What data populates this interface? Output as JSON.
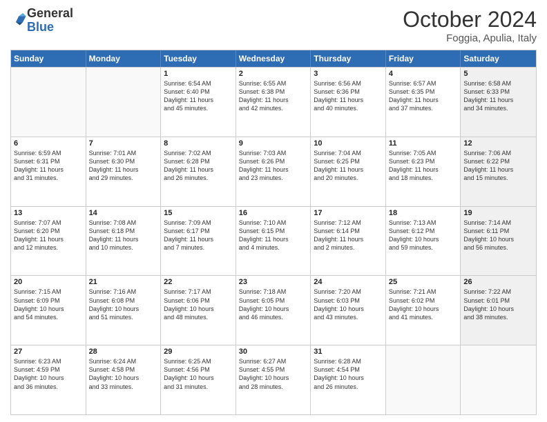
{
  "logo": {
    "general": "General",
    "blue": "Blue"
  },
  "header": {
    "month": "October 2024",
    "location": "Foggia, Apulia, Italy"
  },
  "days_of_week": [
    "Sunday",
    "Monday",
    "Tuesday",
    "Wednesday",
    "Thursday",
    "Friday",
    "Saturday"
  ],
  "weeks": [
    [
      {
        "day": "",
        "lines": [],
        "empty": true
      },
      {
        "day": "",
        "lines": [],
        "empty": true
      },
      {
        "day": "1",
        "lines": [
          "Sunrise: 6:54 AM",
          "Sunset: 6:40 PM",
          "Daylight: 11 hours",
          "and 45 minutes."
        ],
        "empty": false
      },
      {
        "day": "2",
        "lines": [
          "Sunrise: 6:55 AM",
          "Sunset: 6:38 PM",
          "Daylight: 11 hours",
          "and 42 minutes."
        ],
        "empty": false
      },
      {
        "day": "3",
        "lines": [
          "Sunrise: 6:56 AM",
          "Sunset: 6:36 PM",
          "Daylight: 11 hours",
          "and 40 minutes."
        ],
        "empty": false
      },
      {
        "day": "4",
        "lines": [
          "Sunrise: 6:57 AM",
          "Sunset: 6:35 PM",
          "Daylight: 11 hours",
          "and 37 minutes."
        ],
        "empty": false
      },
      {
        "day": "5",
        "lines": [
          "Sunrise: 6:58 AM",
          "Sunset: 6:33 PM",
          "Daylight: 11 hours",
          "and 34 minutes."
        ],
        "empty": false,
        "shaded": true
      }
    ],
    [
      {
        "day": "6",
        "lines": [
          "Sunrise: 6:59 AM",
          "Sunset: 6:31 PM",
          "Daylight: 11 hours",
          "and 31 minutes."
        ],
        "empty": false
      },
      {
        "day": "7",
        "lines": [
          "Sunrise: 7:01 AM",
          "Sunset: 6:30 PM",
          "Daylight: 11 hours",
          "and 29 minutes."
        ],
        "empty": false
      },
      {
        "day": "8",
        "lines": [
          "Sunrise: 7:02 AM",
          "Sunset: 6:28 PM",
          "Daylight: 11 hours",
          "and 26 minutes."
        ],
        "empty": false
      },
      {
        "day": "9",
        "lines": [
          "Sunrise: 7:03 AM",
          "Sunset: 6:26 PM",
          "Daylight: 11 hours",
          "and 23 minutes."
        ],
        "empty": false
      },
      {
        "day": "10",
        "lines": [
          "Sunrise: 7:04 AM",
          "Sunset: 6:25 PM",
          "Daylight: 11 hours",
          "and 20 minutes."
        ],
        "empty": false
      },
      {
        "day": "11",
        "lines": [
          "Sunrise: 7:05 AM",
          "Sunset: 6:23 PM",
          "Daylight: 11 hours",
          "and 18 minutes."
        ],
        "empty": false
      },
      {
        "day": "12",
        "lines": [
          "Sunrise: 7:06 AM",
          "Sunset: 6:22 PM",
          "Daylight: 11 hours",
          "and 15 minutes."
        ],
        "empty": false,
        "shaded": true
      }
    ],
    [
      {
        "day": "13",
        "lines": [
          "Sunrise: 7:07 AM",
          "Sunset: 6:20 PM",
          "Daylight: 11 hours",
          "and 12 minutes."
        ],
        "empty": false
      },
      {
        "day": "14",
        "lines": [
          "Sunrise: 7:08 AM",
          "Sunset: 6:18 PM",
          "Daylight: 11 hours",
          "and 10 minutes."
        ],
        "empty": false
      },
      {
        "day": "15",
        "lines": [
          "Sunrise: 7:09 AM",
          "Sunset: 6:17 PM",
          "Daylight: 11 hours",
          "and 7 minutes."
        ],
        "empty": false
      },
      {
        "day": "16",
        "lines": [
          "Sunrise: 7:10 AM",
          "Sunset: 6:15 PM",
          "Daylight: 11 hours",
          "and 4 minutes."
        ],
        "empty": false
      },
      {
        "day": "17",
        "lines": [
          "Sunrise: 7:12 AM",
          "Sunset: 6:14 PM",
          "Daylight: 11 hours",
          "and 2 minutes."
        ],
        "empty": false
      },
      {
        "day": "18",
        "lines": [
          "Sunrise: 7:13 AM",
          "Sunset: 6:12 PM",
          "Daylight: 10 hours",
          "and 59 minutes."
        ],
        "empty": false
      },
      {
        "day": "19",
        "lines": [
          "Sunrise: 7:14 AM",
          "Sunset: 6:11 PM",
          "Daylight: 10 hours",
          "and 56 minutes."
        ],
        "empty": false,
        "shaded": true
      }
    ],
    [
      {
        "day": "20",
        "lines": [
          "Sunrise: 7:15 AM",
          "Sunset: 6:09 PM",
          "Daylight: 10 hours",
          "and 54 minutes."
        ],
        "empty": false
      },
      {
        "day": "21",
        "lines": [
          "Sunrise: 7:16 AM",
          "Sunset: 6:08 PM",
          "Daylight: 10 hours",
          "and 51 minutes."
        ],
        "empty": false
      },
      {
        "day": "22",
        "lines": [
          "Sunrise: 7:17 AM",
          "Sunset: 6:06 PM",
          "Daylight: 10 hours",
          "and 48 minutes."
        ],
        "empty": false
      },
      {
        "day": "23",
        "lines": [
          "Sunrise: 7:18 AM",
          "Sunset: 6:05 PM",
          "Daylight: 10 hours",
          "and 46 minutes."
        ],
        "empty": false
      },
      {
        "day": "24",
        "lines": [
          "Sunrise: 7:20 AM",
          "Sunset: 6:03 PM",
          "Daylight: 10 hours",
          "and 43 minutes."
        ],
        "empty": false
      },
      {
        "day": "25",
        "lines": [
          "Sunrise: 7:21 AM",
          "Sunset: 6:02 PM",
          "Daylight: 10 hours",
          "and 41 minutes."
        ],
        "empty": false
      },
      {
        "day": "26",
        "lines": [
          "Sunrise: 7:22 AM",
          "Sunset: 6:01 PM",
          "Daylight: 10 hours",
          "and 38 minutes."
        ],
        "empty": false,
        "shaded": true
      }
    ],
    [
      {
        "day": "27",
        "lines": [
          "Sunrise: 6:23 AM",
          "Sunset: 4:59 PM",
          "Daylight: 10 hours",
          "and 36 minutes."
        ],
        "empty": false
      },
      {
        "day": "28",
        "lines": [
          "Sunrise: 6:24 AM",
          "Sunset: 4:58 PM",
          "Daylight: 10 hours",
          "and 33 minutes."
        ],
        "empty": false
      },
      {
        "day": "29",
        "lines": [
          "Sunrise: 6:25 AM",
          "Sunset: 4:56 PM",
          "Daylight: 10 hours",
          "and 31 minutes."
        ],
        "empty": false
      },
      {
        "day": "30",
        "lines": [
          "Sunrise: 6:27 AM",
          "Sunset: 4:55 PM",
          "Daylight: 10 hours",
          "and 28 minutes."
        ],
        "empty": false
      },
      {
        "day": "31",
        "lines": [
          "Sunrise: 6:28 AM",
          "Sunset: 4:54 PM",
          "Daylight: 10 hours",
          "and 26 minutes."
        ],
        "empty": false
      },
      {
        "day": "",
        "lines": [],
        "empty": true
      },
      {
        "day": "",
        "lines": [],
        "empty": true,
        "shaded": true
      }
    ]
  ]
}
